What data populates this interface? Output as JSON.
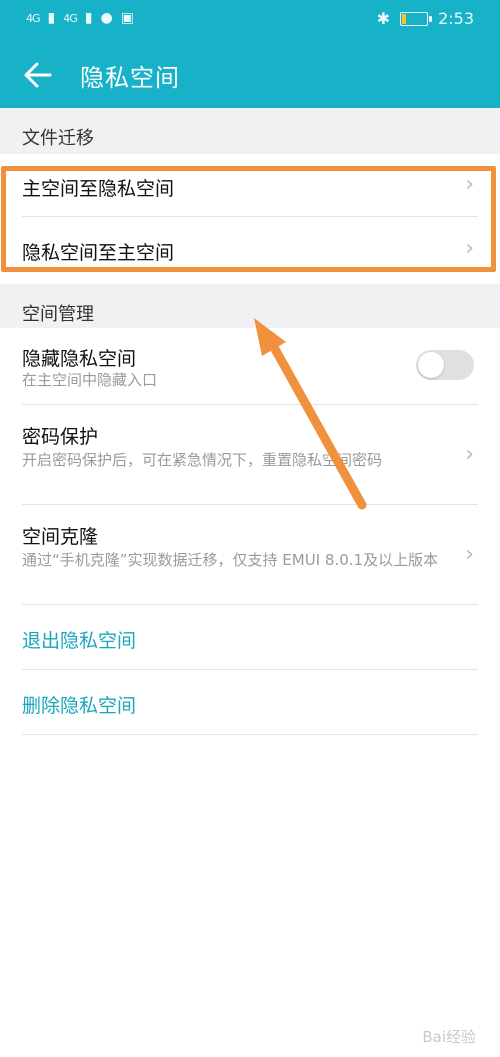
{
  "status_bar": {
    "signal_1": "4G",
    "signal_2": "4G",
    "time": "2:53",
    "icons": [
      "signal-icon",
      "signal-icon",
      "battery-warning-icon",
      "message-icon",
      "lock-icon",
      "bluetooth-icon",
      "battery-icon"
    ],
    "battery_level": 0.15
  },
  "header": {
    "back_icon": "arrow-left-icon",
    "title": "隐私空间"
  },
  "sections": {
    "file_migration": {
      "heading": "文件迁移",
      "items": [
        {
          "title": "主空间至隐私空间",
          "chevron": "›"
        },
        {
          "title": "隐私空间至主空间",
          "chevron": "›"
        }
      ]
    },
    "space_management": {
      "heading": "空间管理",
      "items": [
        {
          "title": "隐藏隐私空间",
          "subtitle": "在主空间中隐藏入口",
          "toggle_on": false
        },
        {
          "title": "密码保护",
          "subtitle": "开启密码保护后，可在紧急情况下，重置隐私空间密码",
          "chevron": "›"
        },
        {
          "title": "空间克隆",
          "subtitle": "通过“手机克隆”实现数据迁移，仅支持 EMUI 8.0.1及以上版本",
          "chevron": "›"
        }
      ]
    },
    "actions": {
      "exit": "退出隐私空间",
      "delete": "删除隐私空间"
    }
  },
  "colors": {
    "header": "#18b2c8",
    "accent_link": "#1aa6bd",
    "annotation": "#f0913e"
  },
  "watermark": "Bai经验"
}
